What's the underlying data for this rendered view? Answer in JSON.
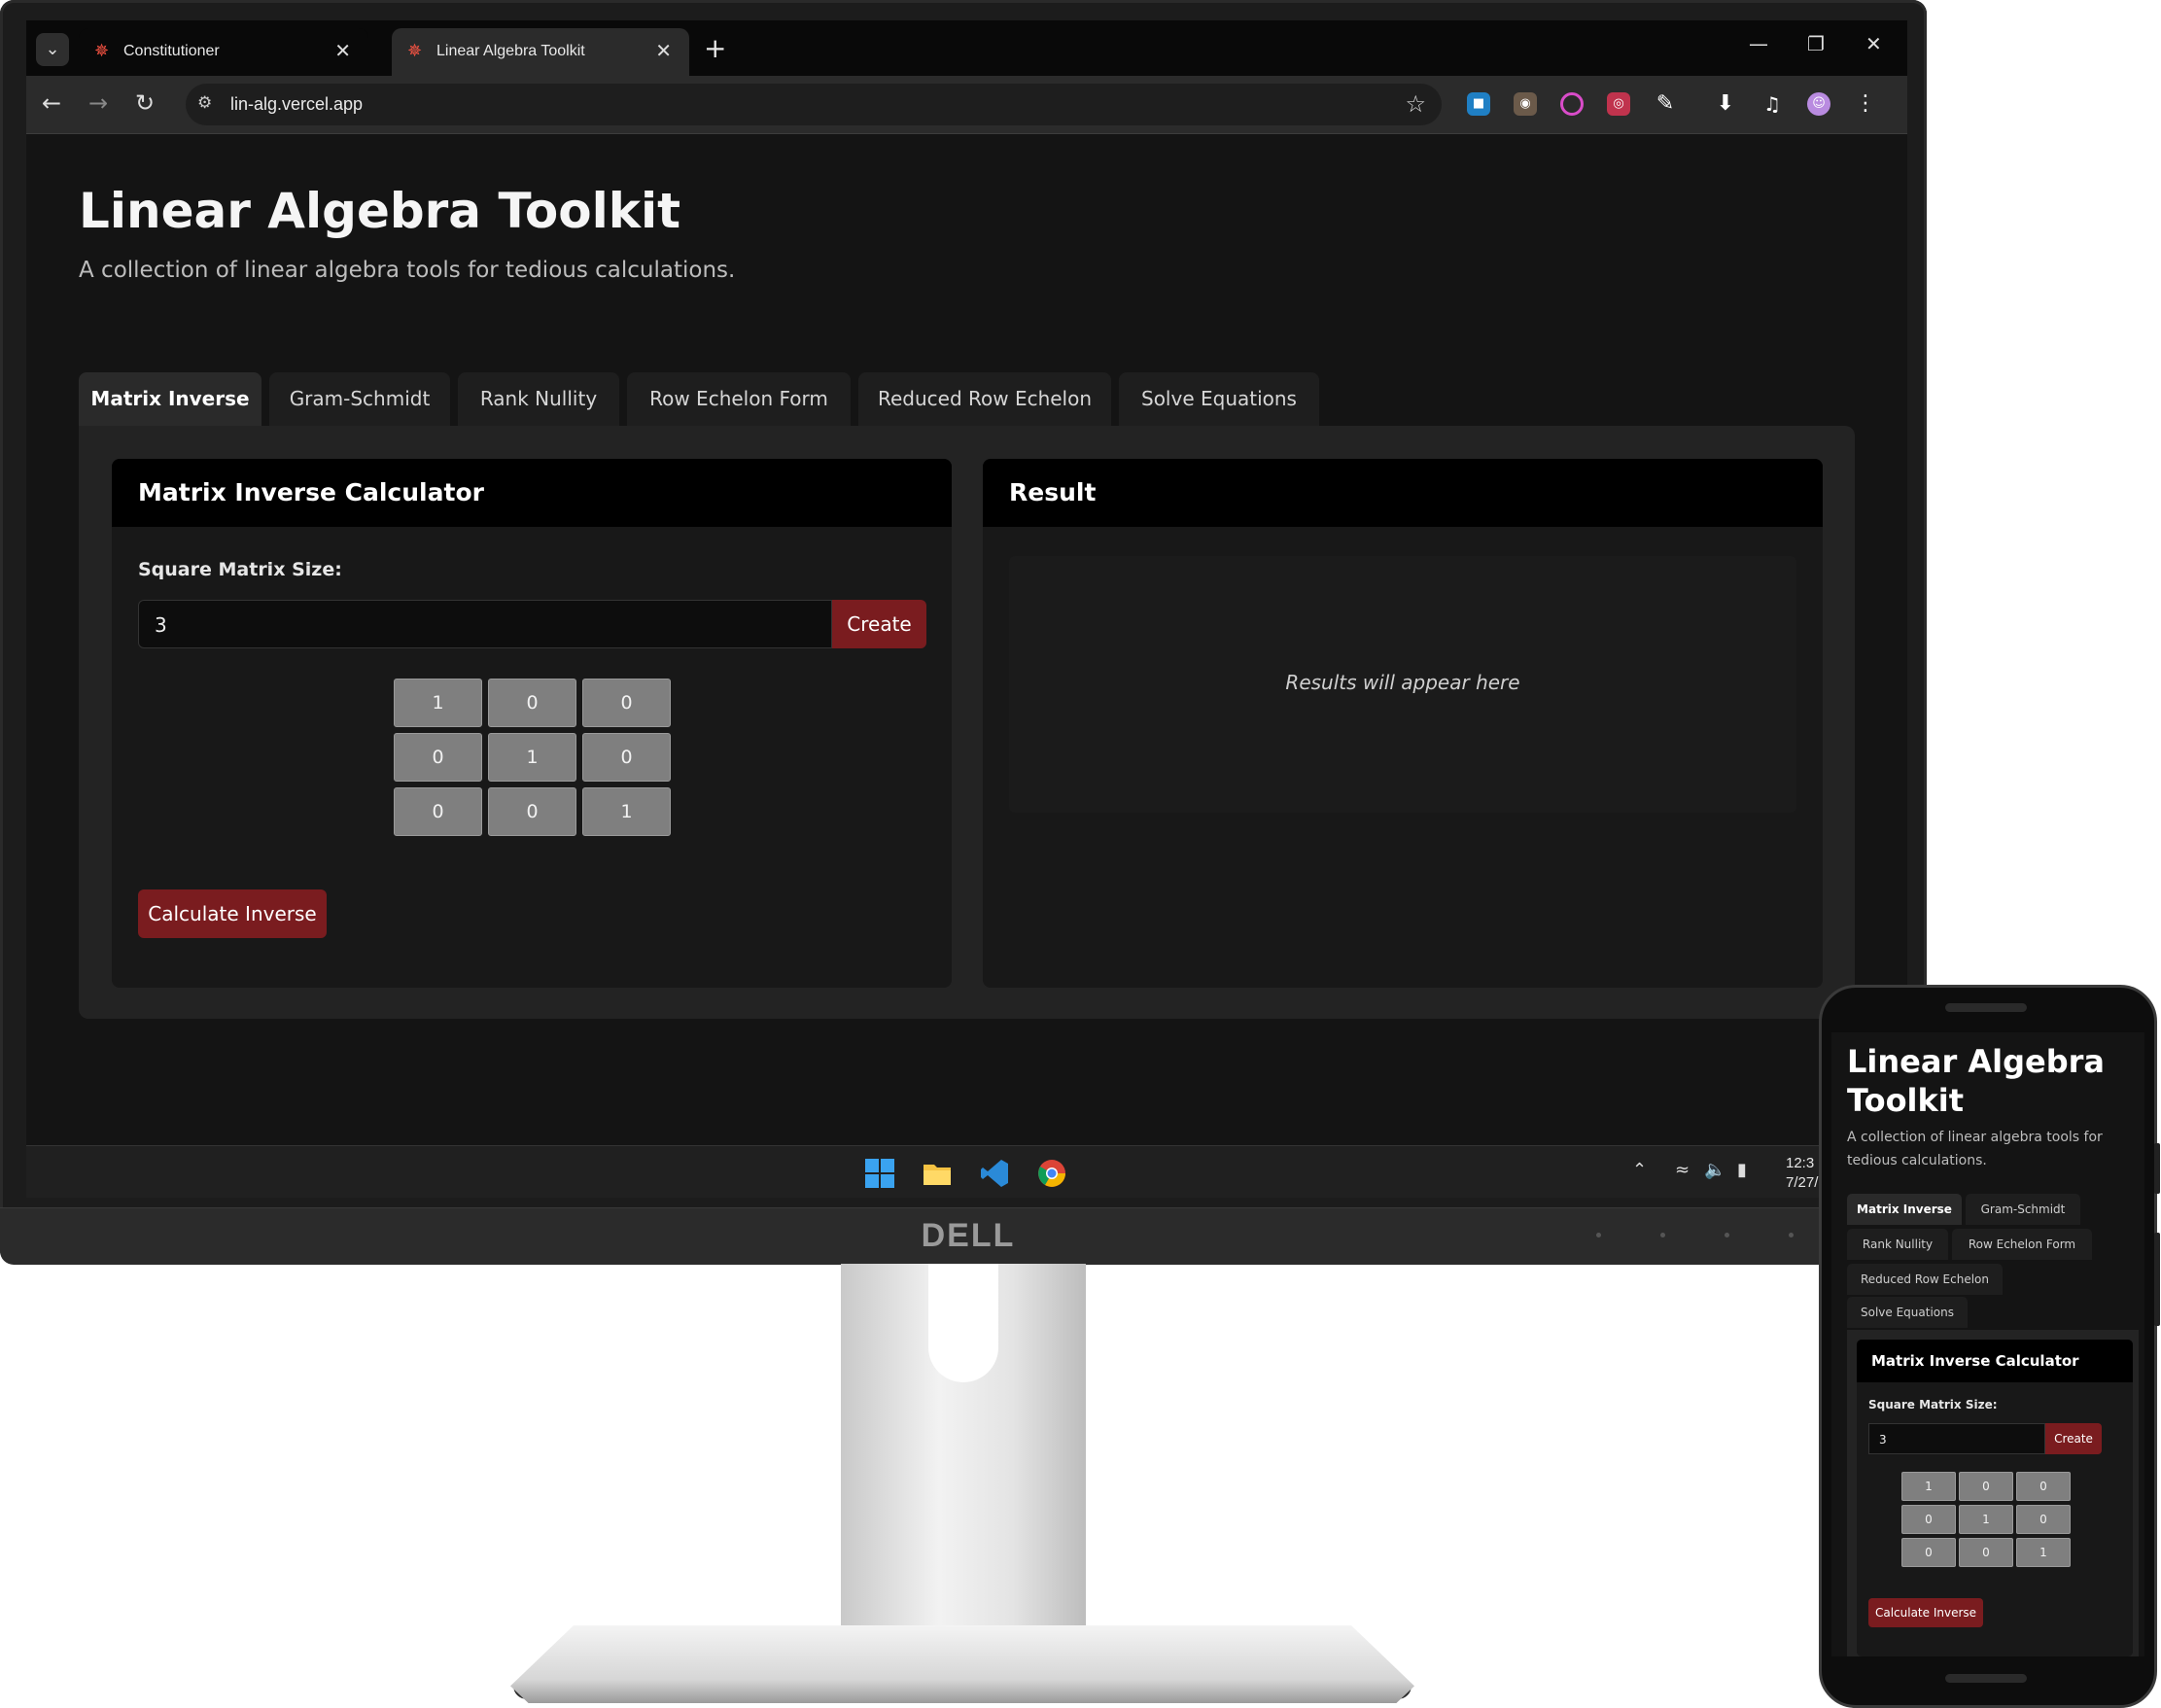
{
  "browser": {
    "tabs": [
      {
        "title": "Constitutioner",
        "active": false
      },
      {
        "title": "Linear Algebra Toolkit",
        "active": true
      }
    ],
    "url": "lin-alg.vercel.app"
  },
  "app": {
    "title": "Linear Algebra Toolkit",
    "subtitle": "A collection of linear algebra tools for tedious calculations.",
    "tabs": [
      "Matrix Inverse",
      "Gram-Schmidt",
      "Rank Nullity",
      "Row Echelon Form",
      "Reduced Row Echelon",
      "Solve Equations"
    ],
    "active_tab": "Matrix Inverse",
    "calculator": {
      "header": "Matrix Inverse Calculator",
      "size_label": "Square Matrix Size:",
      "size_value": "3",
      "create_label": "Create",
      "matrix": [
        [
          "1",
          "0",
          "0"
        ],
        [
          "0",
          "1",
          "0"
        ],
        [
          "0",
          "0",
          "1"
        ]
      ],
      "calculate_label": "Calculate Inverse"
    },
    "result": {
      "header": "Result",
      "placeholder": "Results will appear here"
    }
  },
  "taskbar": {
    "clock_time": "12:3",
    "clock_date": "7/27/"
  },
  "hardware": {
    "brand": "DELL"
  },
  "colors": {
    "accent_button": "#7a1c1f",
    "page_bg": "#141414",
    "card_header_bg": "#000000"
  }
}
